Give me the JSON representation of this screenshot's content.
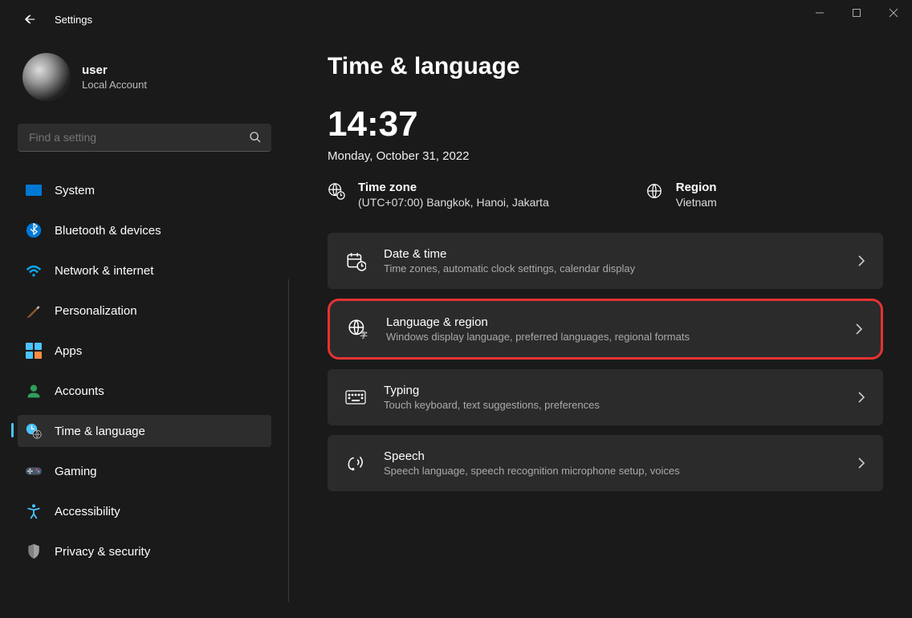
{
  "app_title": "Settings",
  "profile": {
    "name": "user",
    "sub": "Local Account"
  },
  "search": {
    "placeholder": "Find a setting"
  },
  "nav_items": [
    {
      "key": "system",
      "label": "System"
    },
    {
      "key": "bluetooth",
      "label": "Bluetooth & devices"
    },
    {
      "key": "network",
      "label": "Network & internet"
    },
    {
      "key": "personalization",
      "label": "Personalization"
    },
    {
      "key": "apps",
      "label": "Apps"
    },
    {
      "key": "accounts",
      "label": "Accounts"
    },
    {
      "key": "time",
      "label": "Time & language"
    },
    {
      "key": "gaming",
      "label": "Gaming"
    },
    {
      "key": "accessibility",
      "label": "Accessibility"
    },
    {
      "key": "privacy",
      "label": "Privacy & security"
    }
  ],
  "page": {
    "title": "Time & language",
    "clock": "14:37",
    "date": "Monday, October 31, 2022",
    "timezone": {
      "label": "Time zone",
      "value": "(UTC+07:00) Bangkok, Hanoi, Jakarta"
    },
    "region": {
      "label": "Region",
      "value": "Vietnam"
    },
    "cards": [
      {
        "key": "datetime",
        "title": "Date & time",
        "sub": "Time zones, automatic clock settings, calendar display",
        "highlight": false
      },
      {
        "key": "language",
        "title": "Language & region",
        "sub": "Windows display language, preferred languages, regional formats",
        "highlight": true
      },
      {
        "key": "typing",
        "title": "Typing",
        "sub": "Touch keyboard, text suggestions, preferences",
        "highlight": false
      },
      {
        "key": "speech",
        "title": "Speech",
        "sub": "Speech language, speech recognition microphone setup, voices",
        "highlight": false
      }
    ]
  }
}
